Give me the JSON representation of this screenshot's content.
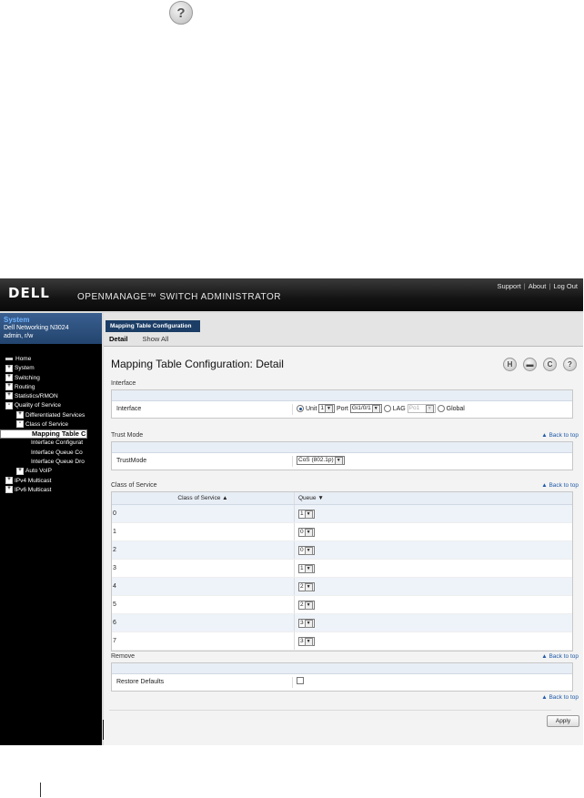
{
  "doc_help_icon": "help-icon",
  "banner": {
    "logo": "DELL",
    "product": "OPENMANAGE™ SWITCH ADMINISTRATOR",
    "links": [
      "Support",
      "About",
      "Log Out"
    ]
  },
  "sidebar": {
    "system_title": "System",
    "device": "Dell Networking N3024",
    "user": "admin, r/w",
    "tree": [
      {
        "label": "Home",
        "indent": 0,
        "marker": "home"
      },
      {
        "label": "System",
        "indent": 0,
        "marker": "+"
      },
      {
        "label": "Switching",
        "indent": 0,
        "marker": "+"
      },
      {
        "label": "Routing",
        "indent": 0,
        "marker": "+"
      },
      {
        "label": "Statistics/RMON",
        "indent": 0,
        "marker": "+"
      },
      {
        "label": "Quality of Service",
        "indent": 0,
        "marker": "-"
      },
      {
        "label": "Differentiated Services",
        "indent": 1,
        "marker": "+"
      },
      {
        "label": "Class of Service",
        "indent": 1,
        "marker": "-"
      },
      {
        "label": "Mapping Table C",
        "indent": 2,
        "marker": "",
        "selected": true
      },
      {
        "label": "Interface Configurat",
        "indent": 2,
        "marker": ""
      },
      {
        "label": "Interface Queue Co",
        "indent": 2,
        "marker": ""
      },
      {
        "label": "Interface Queue Dro",
        "indent": 2,
        "marker": ""
      },
      {
        "label": "Auto VoIP",
        "indent": 1,
        "marker": "+"
      },
      {
        "label": "IPv4 Multicast",
        "indent": 0,
        "marker": "+"
      },
      {
        "label": "IPv6 Multicast",
        "indent": 0,
        "marker": "+"
      }
    ]
  },
  "main": {
    "tab_title": "Mapping Table Configuration",
    "subtabs": [
      "Detail",
      "Show All"
    ],
    "page_title": "Mapping Table Configuration: Detail",
    "tools": [
      "save-icon",
      "print-icon",
      "refresh-icon",
      "help-icon"
    ],
    "back_to_top": "▲ Back to top",
    "interface": {
      "section": "Interface",
      "label": "Interface",
      "unit_label": "Unit",
      "unit_value": "1",
      "port_label": "Port",
      "port_value": "Gi1/0/1",
      "lag_label": "LAG",
      "lag_value": "Po1",
      "global_label": "Global"
    },
    "trust": {
      "section": "Trust Mode",
      "label": "TrustMode",
      "value": "CoS (802.1p)"
    },
    "cos": {
      "section": "Class of Service",
      "col1": "Class of Service ▲",
      "col2": "Queue ▼",
      "rows": [
        {
          "cos": "0",
          "queue": "1"
        },
        {
          "cos": "1",
          "queue": "0"
        },
        {
          "cos": "2",
          "queue": "0"
        },
        {
          "cos": "3",
          "queue": "1"
        },
        {
          "cos": "4",
          "queue": "2"
        },
        {
          "cos": "5",
          "queue": "2"
        },
        {
          "cos": "6",
          "queue": "3"
        },
        {
          "cos": "7",
          "queue": "3"
        }
      ]
    },
    "remove": {
      "section": "Remove",
      "label": "Restore Defaults"
    },
    "apply_label": "Apply"
  }
}
